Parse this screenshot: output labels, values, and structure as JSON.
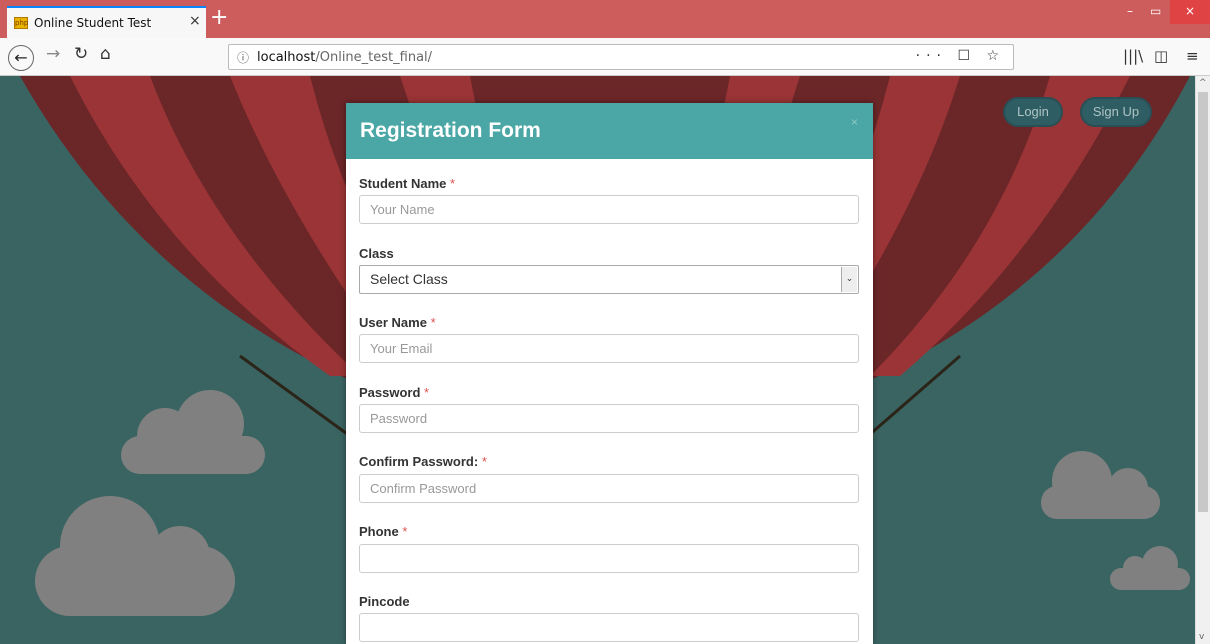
{
  "browser": {
    "tab_title": "Online Student Test",
    "tab_close": "×",
    "new_tab": "+",
    "url_host": "localhost",
    "url_path": "/Online_test_final/",
    "url_actions": "··· ☐ ☆",
    "minimize": "–",
    "maximize": "▭",
    "close": "×",
    "library_icon": "|||\\",
    "sidebar_icon": "◫",
    "menu_icon": "≡"
  },
  "page": {
    "login_label": "Login",
    "signup_label": "Sign Up",
    "colors": {
      "background": "#3a6462",
      "balloon_dark": "#6b2628",
      "balloon_light": "#9a3436",
      "cloud": "#808080",
      "modal_header": "#4ba7a5",
      "required": "#d9534f"
    }
  },
  "modal": {
    "title": "Registration Form",
    "close": "×",
    "fields": [
      {
        "label": "Student Name",
        "required": "*",
        "placeholder": "Your Name"
      },
      {
        "label": "Class",
        "required": "",
        "value": "Select Class"
      },
      {
        "label": "User Name",
        "required": "*",
        "placeholder": "Your Email"
      },
      {
        "label": "Password",
        "required": "*",
        "placeholder": "Password"
      },
      {
        "label": "Confirm Password:",
        "required": "*",
        "placeholder": "Confirm Password"
      },
      {
        "label": "Phone",
        "required": "*",
        "placeholder": ""
      },
      {
        "label": "Pincode",
        "required": "",
        "placeholder": ""
      }
    ]
  }
}
